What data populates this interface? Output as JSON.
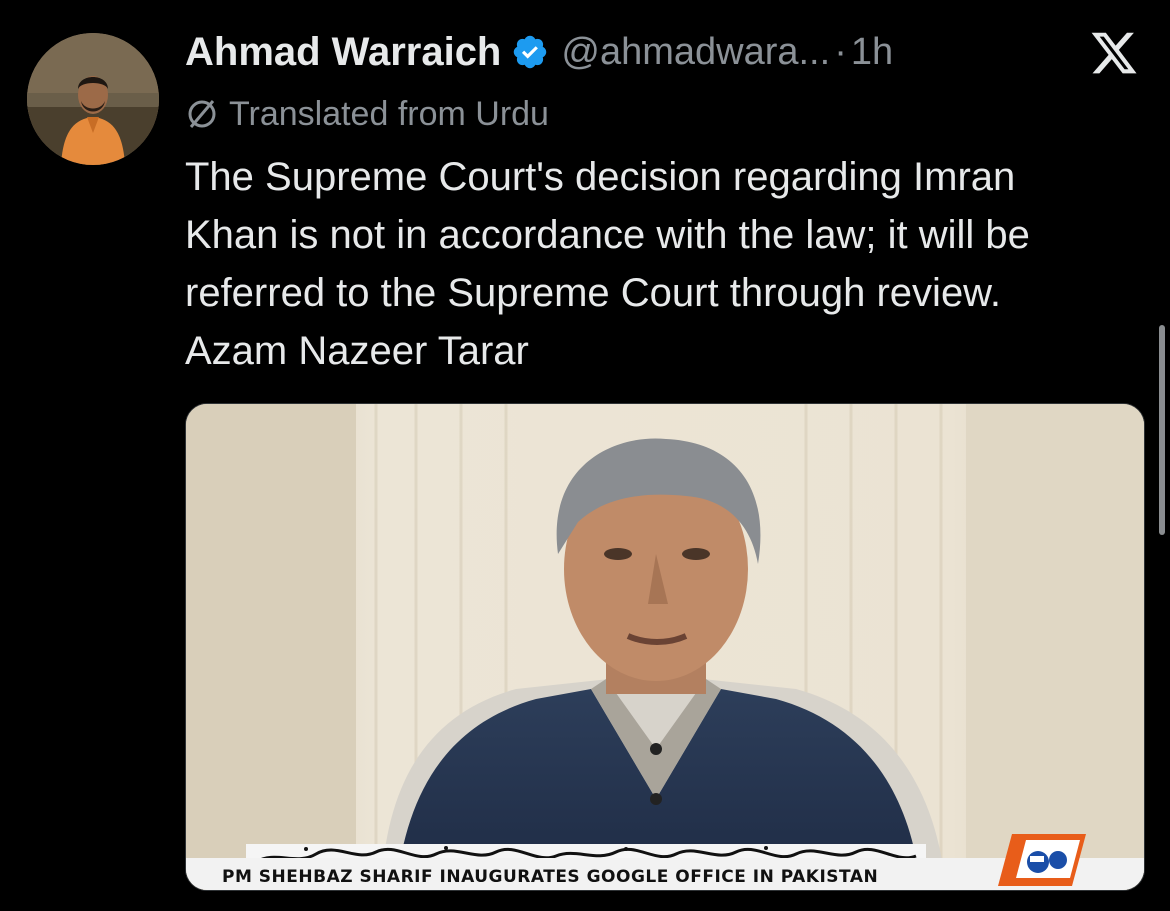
{
  "tweet": {
    "author": {
      "display_name": "Ahmad Warraich",
      "handle": "@ahmadwara...",
      "verified": true,
      "verified_color": "#1d9bf0"
    },
    "separator": "·",
    "time": "1h",
    "translated_label": "Translated from Urdu",
    "text_lines": [
      "The Supreme Court's decision regarding Imran",
      "Khan is not in accordance with the law; it will be",
      "referred to the Supreme Court through review.",
      "Azam Nazeer Tarar"
    ],
    "media": {
      "ticker_text": "PM SHEHBAZ SHARIF INAUGURATES GOOGLE OFFICE IN PAKISTAN"
    }
  },
  "icons": {
    "verified": "verified-badge-icon",
    "translate": "globe-icon",
    "brand": "x-logo-icon",
    "channel": "channel-logo-icon"
  },
  "colors": {
    "background": "#000000",
    "text_primary": "#e7e9ea",
    "text_secondary": "#8b9197",
    "verified": "#1d9bf0"
  }
}
